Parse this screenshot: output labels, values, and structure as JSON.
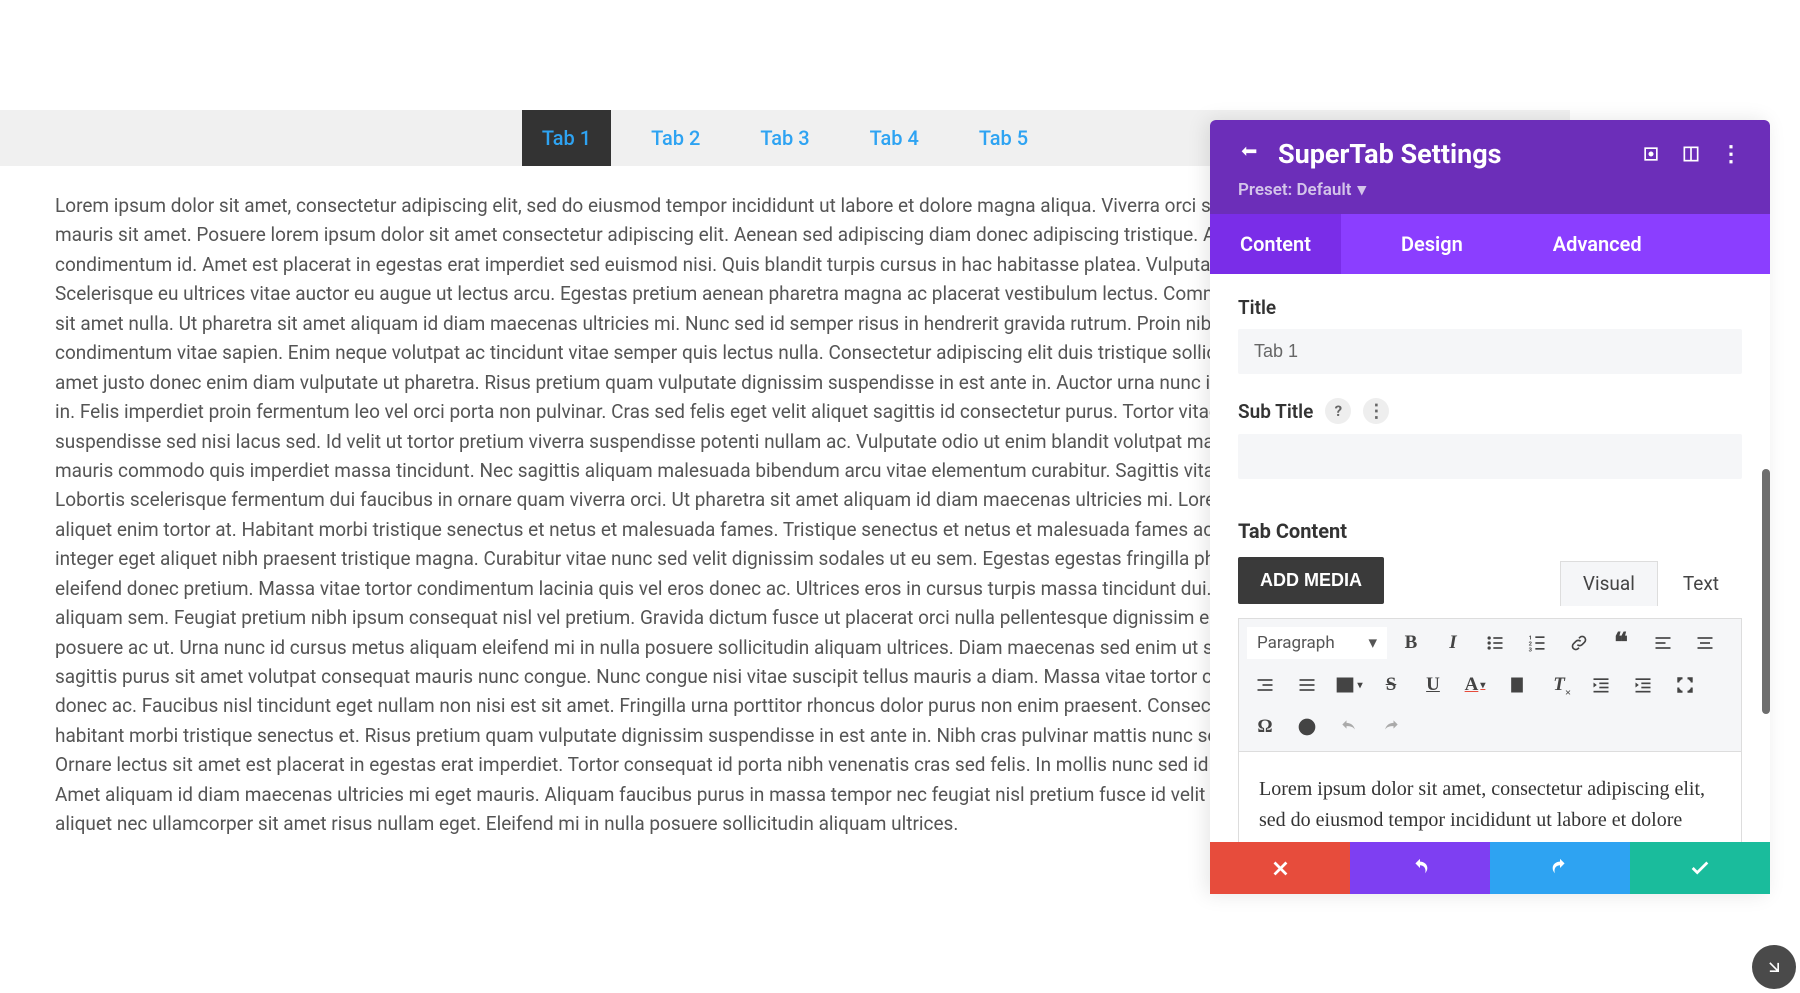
{
  "tabs": [
    "Tab 1",
    "Tab 2",
    "Tab 3",
    "Tab 4",
    "Tab 5"
  ],
  "content_text": "Lorem ipsum dolor sit amet, consectetur adipiscing elit, sed do eiusmod tempor incididunt ut labore et dolore magna aliqua. Viverra orci sagittis eu volutpat odio facilisis mauris sit amet. Posuere lorem ipsum dolor sit amet consectetur adipiscing elit. Aenean sed adipiscing diam donec adipiscing tristique. Aliquet lectus proin nibh nisl condimentum id. Amet est placerat in egestas erat imperdiet sed euismod nisi. Quis blandit turpis cursus in hac habitasse platea. Vulputate mi sit amet mauris commodo. Scelerisque eu ultrices vitae auctor eu augue ut lectus arcu. Egestas pretium aenean pharetra magna ac placerat vestibulum lectus. Commodo elit at imperdiet dui accumsan sit amet nulla. Ut pharetra sit amet aliquam id diam maecenas ultricies mi. Nunc sed id semper risus in hendrerit gravida rutrum. Proin nibh nisl condimentum id venenatis a condimentum vitae sapien. Enim neque volutpat ac tincidunt vitae semper quis lectus nulla. Consectetur adipiscing elit duis tristique sollicitudin nibh sit amet commodo. Sit amet justo donec enim diam vulputate ut pharetra. Risus pretium quam vulputate dignissim suspendisse in est ante in. Auctor urna nunc id cursus metus aliquam eleifend mi in. Felis imperdiet proin fermentum leo vel orci porta non pulvinar. Cras sed felis eget velit aliquet sagittis id consectetur purus. Tortor vitae purus faucibus ornare suspendisse sed nisi lacus sed. Id velit ut tortor pretium viverra suspendisse potenti nullam ac. Vulputate odio ut enim blandit volutpat maecenas volutpat blandit. Mi sit amet mauris commodo quis imperdiet massa tincidunt. Nec sagittis aliquam malesuada bibendum arcu vitae elementum curabitur. Sagittis vitae et leo duis ut diam quam. Lobortis scelerisque fermentum dui faucibus in ornare quam viverra orci. Ut pharetra sit amet aliquam id diam maecenas ultricies mi. Lorem sed risus ultricies tristique nulla aliquet enim tortor at. Habitant morbi tristique senectus et netus et malesuada fames. Tristique senectus et netus et malesuada fames ac turpis egestas. Ac turpis egestas integer eget aliquet nibh praesent tristique magna. Curabitur vitae nunc sed velit dignissim sodales ut eu sem. Egestas egestas fringilla phasellus faucibus scelerisque eleifend donec pretium. Massa vitae tortor condimentum lacinia quis vel eros donec ac. Ultrices eros in cursus turpis massa tincidunt dui. Nunc scelerisque viverra mauris in aliquam sem. Feugiat pretium nibh ipsum consequat nisl vel pretium. Gravida dictum fusce ut placerat orci nulla pellentesque dignissim enim. Lacus luctus accumsan tortor posuere ac ut. Urna nunc id cursus metus aliquam eleifend mi in nulla posuere sollicitudin aliquam ultrices. Diam maecenas sed enim ut sem viverra aliquet eget sit. Quisque sagittis purus sit amet volutpat consequat mauris nunc congue. Nunc congue nisi vitae suscipit tellus mauris a diam. Massa vitae tortor condimentum lacinia quis vel eros donec ac. Faucibus nisl tincidunt eget nullam non nisi est sit amet. Fringilla urna porttitor rhoncus dolor purus non enim praesent. Consectetur adipiscing elit pellentesque habitant morbi tristique senectus et. Risus pretium quam vulputate dignissim suspendisse in est ante in. Nibh cras pulvinar mattis nunc sed blandit libero volutpat sed. Ornare lectus sit amet est placerat in egestas erat imperdiet. Tortor consequat id porta nibh venenatis cras sed felis. In mollis nunc sed id semper risus in hendrerit gravida. Amet aliquam id diam maecenas ultricies mi eget mauris. Aliquam faucibus purus in massa tempor nec feugiat nisl pretium fusce id velit ut tortor pretium. Faucibus vitae aliquet nec ullamcorper sit amet risus nullam eget. Eleifend mi in nulla posuere sollicitudin aliquam ultrices.",
  "panel": {
    "title": "SuperTab Settings",
    "preset": "Preset: Default",
    "tabs": {
      "content": "Content",
      "design": "Design",
      "advanced": "Advanced"
    },
    "fields": {
      "title_label": "Title",
      "title_value": "Tab 1",
      "subtitle_label": "Sub Title",
      "subtitle_value": "",
      "tab_content_label": "Tab Content",
      "add_media": "ADD MEDIA",
      "visual_tab": "Visual",
      "text_tab": "Text",
      "paragraph_select": "Paragraph",
      "editor_content": "Lorem ipsum dolor sit amet, consectetur adipiscing elit, sed do eiusmod tempor incididunt ut labore et dolore magna aliqua. Viverra orci sagittis eu volutpat odio facilisis mauris sit amet. Posuere lorem ipsum dolor"
    }
  },
  "help_glyph": "?",
  "dots_glyph": "⋮"
}
